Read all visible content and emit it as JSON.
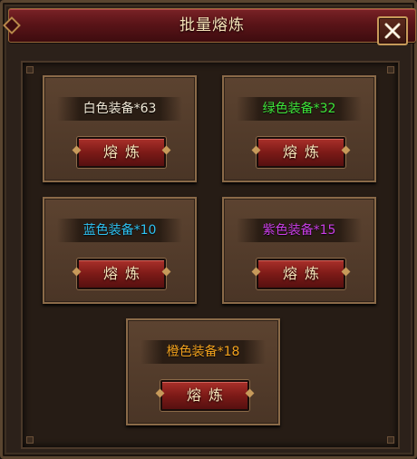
{
  "dialog": {
    "title": "批量熔炼",
    "close_icon": "close-x-icon"
  },
  "cards": [
    {
      "label": "白色装备*63",
      "color": "#f2ead8",
      "button": "熔炼"
    },
    {
      "label": "绿色装备*32",
      "color": "#3ee63a",
      "button": "熔炼"
    },
    {
      "label": "蓝色装备*10",
      "color": "#2ec2f2",
      "button": "熔炼"
    },
    {
      "label": "紫色装备*15",
      "color": "#c93ee6",
      "button": "熔炼"
    },
    {
      "label": "橙色装备*18",
      "color": "#f2a21e",
      "button": "熔炼"
    }
  ]
}
